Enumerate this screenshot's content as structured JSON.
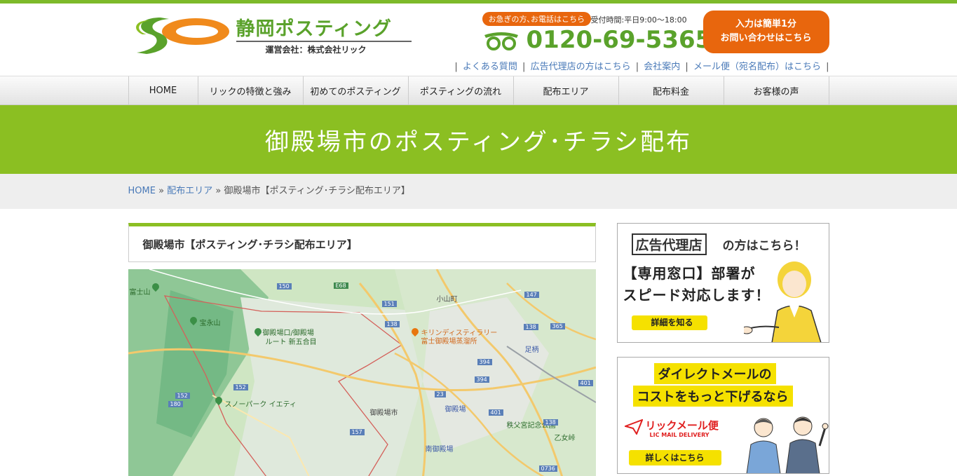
{
  "header": {
    "logo_title": "静岡ポスティング",
    "logo_sub": "運営会社：株式会社リック",
    "tel_badge": "お急ぎの方､お電話はこちら",
    "tel_hours": "受付時間:平日9:00〜18:00",
    "tel_number": "0120-69-5365",
    "contact_line1": "入力は簡単1分",
    "contact_line2": "お問い合わせはこちら",
    "sublinks": [
      "よくある質問",
      "広告代理店の方はこちら",
      "会社案内",
      "メール便（宛名配布）はこちら"
    ]
  },
  "nav": [
    "HOME",
    "リックの特徴と強み",
    "初めてのポスティング",
    "ポスティングの流れ",
    "配布エリア",
    "配布料金",
    "お客様の声"
  ],
  "banner_title": "御殿場市のポスティング･チラシ配布",
  "breadcrumb": {
    "home": "HOME",
    "sep": "»",
    "area": "配布エリア",
    "current": "御殿場市【ポスティング･チラシ配布エリア】"
  },
  "section_title": "御殿場市【ポスティング･チラシ配布エリア】",
  "map": {
    "labels": [
      "富士山",
      "宝永山",
      "御殿場口/御殿場",
      "ルート 新五合目",
      "キリンディスティラリー",
      "富士御殿場蒸溜所",
      "スノーパーク イエティ",
      "御殿場市",
      "御殿場",
      "南御殿場",
      "小山町",
      "足柄",
      "秩父宮記念公園",
      "乙女峠"
    ],
    "routes": [
      "150",
      "E68",
      "151",
      "138",
      "147",
      "365",
      "138",
      "394",
      "394",
      "401",
      "152",
      "152",
      "180",
      "23",
      "401",
      "157",
      "138",
      "0736"
    ]
  },
  "ads": {
    "agency": {
      "headline_box": "広告代理店",
      "headline_rest": "の方はこちら！",
      "line1": "【専用窓口】部署が",
      "line2": "スピード対応します！",
      "button": "詳細を知る"
    },
    "mail": {
      "line1": "ダイレクトメールの",
      "line2": "コストをもっと下げるなら",
      "brand": "リックメール便",
      "brand_en": "LIC MAIL DELIVERY",
      "button": "詳しくはこちら"
    }
  },
  "colors": {
    "green": "#8bbf22",
    "orange": "#e8660d",
    "link": "#4a7ab8",
    "yellow": "#f5e100"
  }
}
